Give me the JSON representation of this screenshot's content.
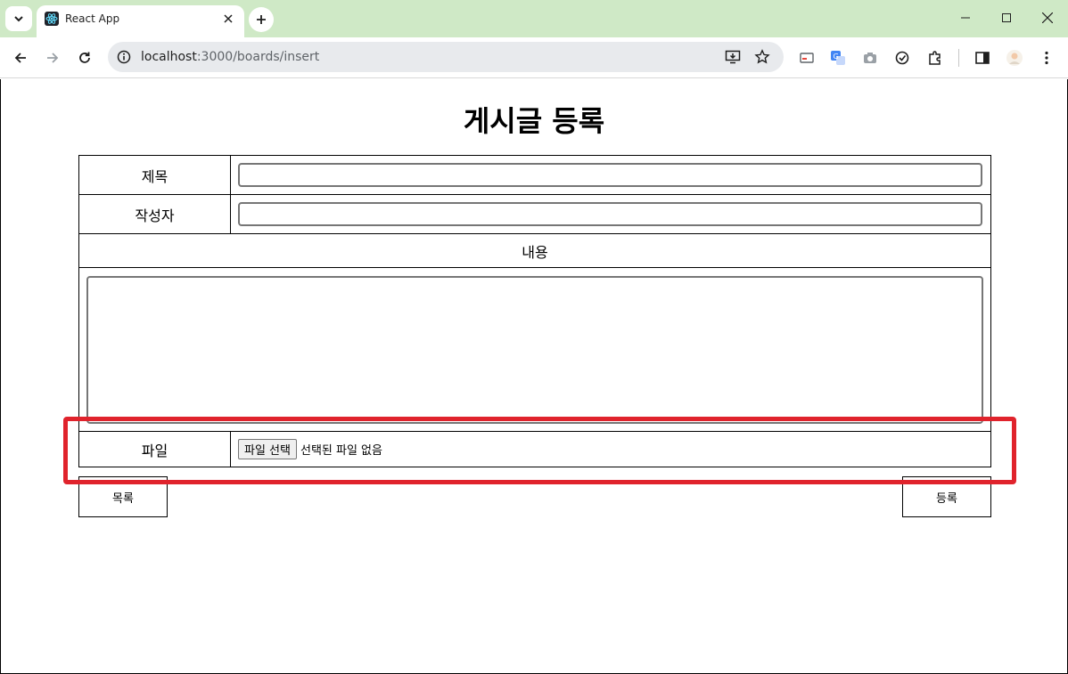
{
  "browser": {
    "tab_title": "React App",
    "url_host": "localhost",
    "url_path": ":3000/boards/insert"
  },
  "page": {
    "title": "게시글 등록",
    "form": {
      "title_label": "제목",
      "writer_label": "작성자",
      "content_label": "내용",
      "file_label": "파일",
      "file_button": "파일 선택",
      "file_status": "선택된 파일 없음"
    },
    "buttons": {
      "list": "목록",
      "submit": "등록"
    }
  },
  "colors": {
    "tabstrip": "#cfe9c6",
    "highlight": "#e0232c"
  }
}
